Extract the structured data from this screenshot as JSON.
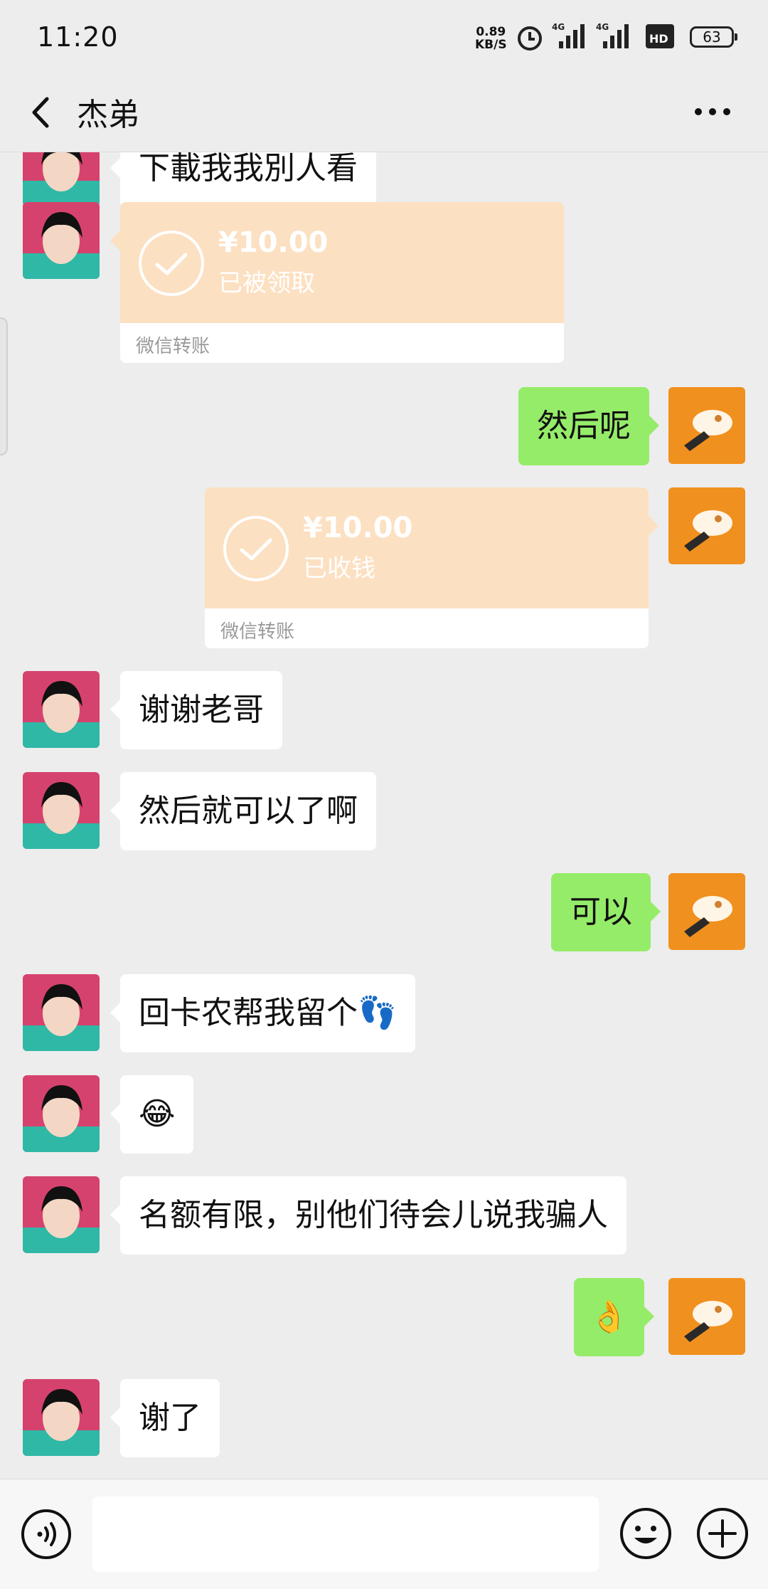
{
  "status_bar": {
    "time": "11:20",
    "net_speed_value": "0.89",
    "net_speed_unit": "KB/S",
    "signal1_label": "4G",
    "signal2_label": "4G",
    "hd_label": "HD",
    "battery": "63"
  },
  "header": {
    "title": "杰弟",
    "back_icon": "chevron-left-icon",
    "more_icon": "more-dots-icon"
  },
  "messages": [
    {
      "type": "text",
      "from": "friend",
      "text": "下載我我別人看"
    },
    {
      "type": "transfer",
      "from": "friend",
      "amount": "¥10.00",
      "status": "已被领取",
      "footer": "微信转账"
    },
    {
      "type": "text",
      "from": "me",
      "text": "然后呢"
    },
    {
      "type": "transfer",
      "from": "me",
      "amount": "¥10.00",
      "status": "已收钱",
      "footer": "微信转账"
    },
    {
      "type": "text",
      "from": "friend",
      "text": "谢谢老哥"
    },
    {
      "type": "text",
      "from": "friend",
      "text": "然后就可以了啊"
    },
    {
      "type": "text",
      "from": "me",
      "text": "可以"
    },
    {
      "type": "text",
      "from": "friend",
      "text": "回卡农帮我留个👣"
    },
    {
      "type": "text",
      "from": "friend",
      "text": "😂"
    },
    {
      "type": "text",
      "from": "friend",
      "text": "名额有限，别他们待会儿说我骗人"
    },
    {
      "type": "text",
      "from": "me",
      "text": "👌"
    },
    {
      "type": "text",
      "from": "friend",
      "text": "谢了"
    }
  ],
  "input_bar": {
    "input_value": "",
    "voice_icon": "voice-icon",
    "emoji_icon": "emoji-icon",
    "plus_icon": "plus-icon"
  },
  "colors": {
    "background": "#ededed",
    "outgoing_bubble": "#95ec69",
    "incoming_bubble": "#ffffff",
    "transfer_card": "#fce0c2",
    "my_avatar": "#f0901e",
    "friend_avatar": "#d6426e"
  }
}
